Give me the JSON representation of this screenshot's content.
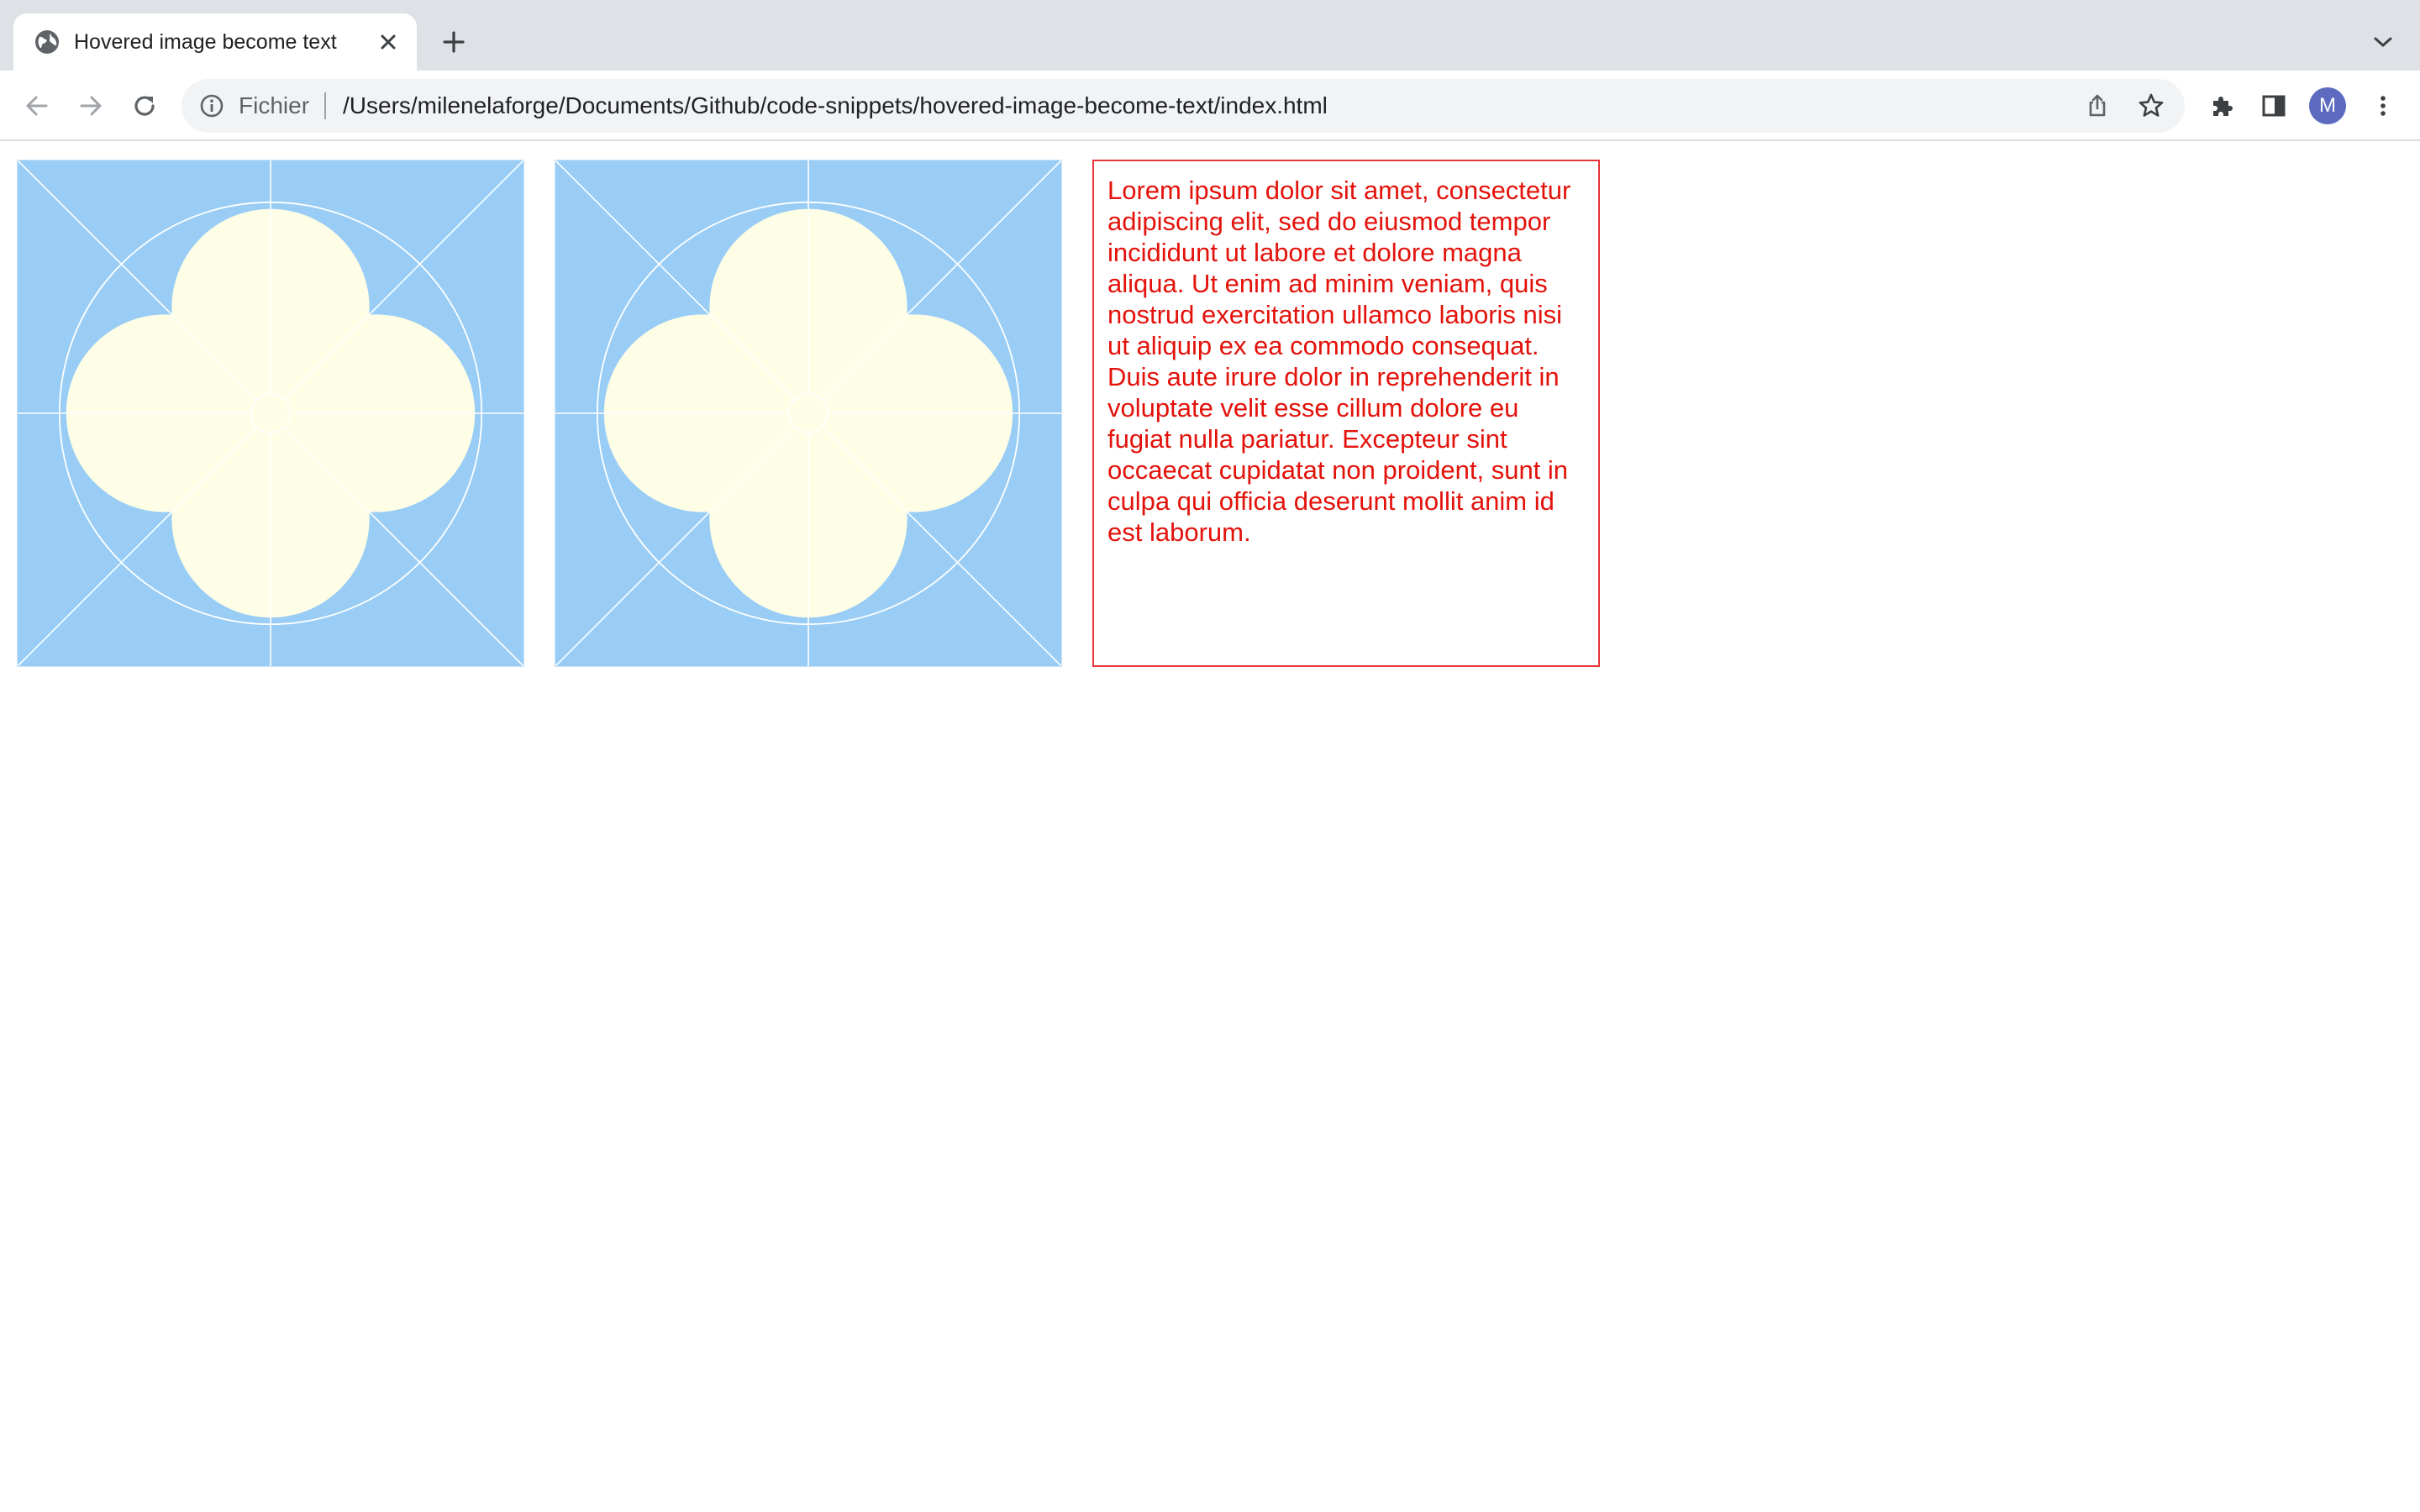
{
  "browser": {
    "tab": {
      "title": "Hovered image become text",
      "favicon": "globe-icon",
      "close_icon": "close-icon"
    },
    "new_tab_icon": "plus-icon",
    "tab_search_icon": "chevron-down-icon",
    "toolbar": {
      "back_icon": "arrow-left-icon",
      "forward_icon": "arrow-right-icon",
      "reload_icon": "reload-icon",
      "extensions_icon": "puzzle-icon",
      "side_panel_icon": "side-panel-icon",
      "menu_icon": "kebab-menu-icon"
    },
    "omnibox": {
      "info_icon": "info-icon",
      "scheme": "Fichier",
      "url": "/Users/milenelaforge/Documents/Github/code-snippets/hovered-image-become-text/index.html",
      "share_icon": "share-icon",
      "bookmark_icon": "star-icon"
    },
    "profile_initial": "M"
  },
  "page": {
    "tiles": [
      {
        "name": "quatrefoil-image-1"
      },
      {
        "name": "quatrefoil-image-2"
      }
    ],
    "tile_colors": {
      "background": "#99cdf5",
      "petal": "#fefee6",
      "line": "#ffffff"
    },
    "text_card": {
      "text": "Lorem ipsum dolor sit amet, consectetur adipiscing elit, sed do eiusmod tempor incididunt ut labore et dolore magna aliqua. Ut enim ad minim veniam, quis nostrud exercitation ullamco laboris nisi ut aliquip ex ea commodo consequat. Duis aute irure dolor in reprehenderit in voluptate velit esse cillum dolore eu fugiat nulla pariatur. Excepteur sint occaecat cupidatat non proident, sunt in culpa qui officia deserunt mollit anim id est laborum.",
      "color": "#e3120b",
      "border_color": "#e8343a"
    }
  }
}
